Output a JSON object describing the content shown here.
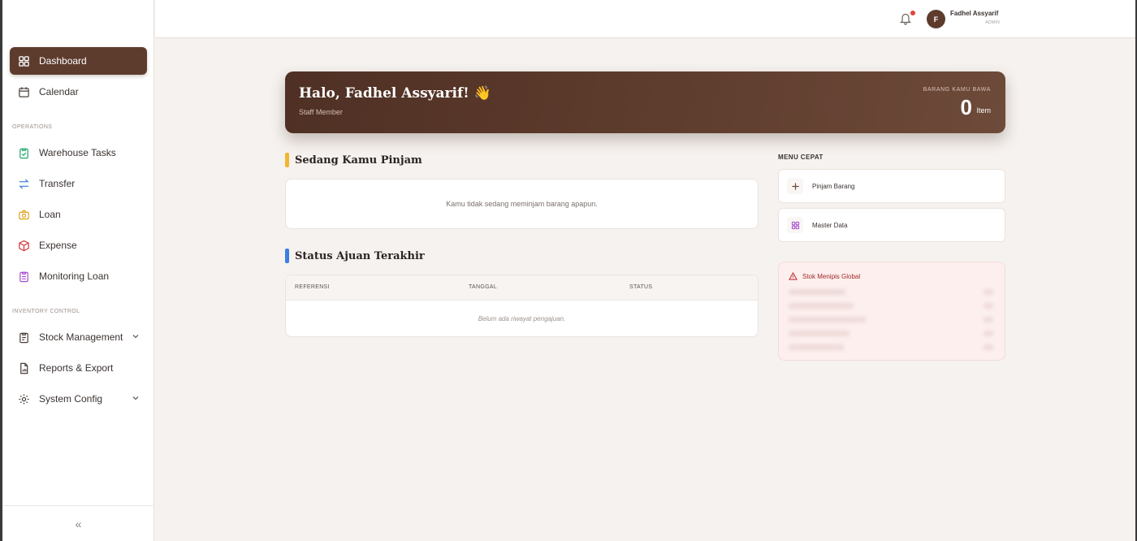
{
  "sidebar": {
    "items": [
      {
        "label": "Dashboard",
        "icon": "grid-icon",
        "active": true
      },
      {
        "label": "Calendar",
        "icon": "calendar-icon"
      },
      {
        "label": "Warehouse Tasks",
        "icon": "clipboard-check-icon"
      },
      {
        "label": "Transfer",
        "icon": "transfer-icon"
      },
      {
        "label": "Loan",
        "icon": "camera-icon"
      },
      {
        "label": "Expense",
        "icon": "box-icon"
      },
      {
        "label": "Monitoring Loan",
        "icon": "clipboard-list-icon"
      },
      {
        "label": "Stock Management",
        "icon": "clipboard-icon"
      },
      {
        "label": "Reports & Export",
        "icon": "report-icon"
      },
      {
        "label": "System Config",
        "icon": "settings-icon"
      }
    ],
    "sections": {
      "operations": "OPERATIONS",
      "inventory": "INVENTORY CONTROL"
    },
    "collapse_glyph": "«"
  },
  "topbar": {
    "user_initial": "F",
    "user_name": "Fadhel Assyarif",
    "user_role": "ADMIN"
  },
  "hero": {
    "greeting": "Halo, Fadhel Assyarif! 👋",
    "subtitle": "Staff Member",
    "kicker": "BARANG KAMU BAWA",
    "count": "0",
    "unit": "Item"
  },
  "borrowing": {
    "title": "Sedang Kamu Pinjam",
    "empty": "Kamu tidak sedang meminjam barang apapun."
  },
  "status": {
    "title": "Status Ajuan Terakhir",
    "columns": [
      "REFERENSI",
      "TANGGAL",
      "STATUS"
    ],
    "empty": "Belum ada riwayat pengajuan."
  },
  "quick_menu": {
    "title": "MENU CEPAT",
    "items": [
      {
        "label": "Pinjam Barang",
        "icon": "plus-icon"
      },
      {
        "label": "Master Data",
        "icon": "grid-icon"
      }
    ]
  },
  "low_stock": {
    "title": "Stok Menipis Global"
  },
  "colors": {
    "brand": "#5d3c2e",
    "accent_yellow": "#f2b630",
    "accent_blue": "#3b7fe0",
    "danger": "#a22a2a"
  }
}
